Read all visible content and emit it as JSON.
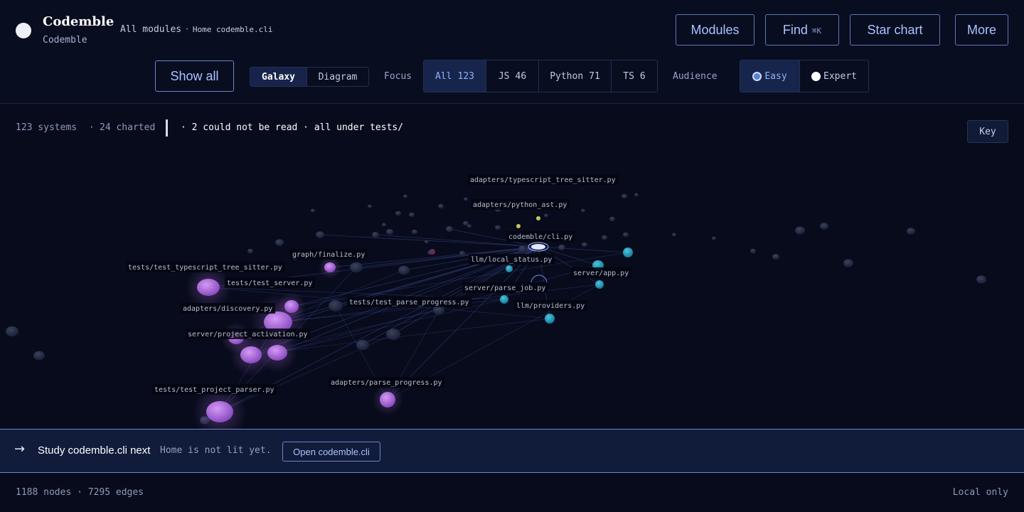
{
  "header": {
    "title": "Codemble",
    "subtitle": "Codemble",
    "breadcrumb": {
      "root": "All modules",
      "sep": "·",
      "tail": "Home codemble.cli"
    },
    "buttons": {
      "modules": "Modules",
      "find": "Find",
      "find_shortcut": "⌘K",
      "star_chart": "Star chart",
      "more": "More"
    }
  },
  "toolbar": {
    "show_all": "Show all",
    "view_modes": [
      "Galaxy",
      "Diagram"
    ],
    "active_view": "Galaxy",
    "focus_label": "Focus",
    "focus_filters": [
      {
        "label": "All",
        "count": "123"
      },
      {
        "label": "JS",
        "count": "46"
      },
      {
        "label": "Python",
        "count": "71"
      },
      {
        "label": "TS",
        "count": "6"
      }
    ],
    "audience_label": "Audience",
    "audience_options": [
      "Easy",
      "Expert"
    ],
    "audience_selected": "Easy"
  },
  "status": {
    "systems": "123 systems",
    "dot": "·",
    "charted": "24 charted",
    "warning": "· 2 could not be read · all under tests/",
    "key_button": "Key"
  },
  "graph": {
    "labels": [
      "adapters/typescript_tree_sitter.py",
      "adapters/python_ast.py",
      "codemble/cli.py",
      "graph/finalize.py",
      "llm/local_status.py",
      "tests/test_typescript_tree_sitter.py",
      "server/app.py",
      "tests/test_server.py",
      "server/parse_job.py",
      "tests/test_parse_progress.py",
      "llm/providers.py",
      "adapters/discovery.py",
      "server/project_activation.py",
      "adapters/parse_progress.py",
      "tests/test_project_parser.py"
    ],
    "colors": {
      "purple": "#b46ee0",
      "cyan": "#31a8c4",
      "grey": "#26304a",
      "highlight": "#dfe8ff",
      "edge": "#3a4a8c"
    }
  },
  "banner": {
    "arrow": "→",
    "study": "Study codemble.cli next",
    "note": "Home is not lit yet.",
    "open_button": "Open codemble.cli"
  },
  "footer": {
    "stats": "1188 nodes · 7295 edges",
    "mode": "Local only"
  }
}
